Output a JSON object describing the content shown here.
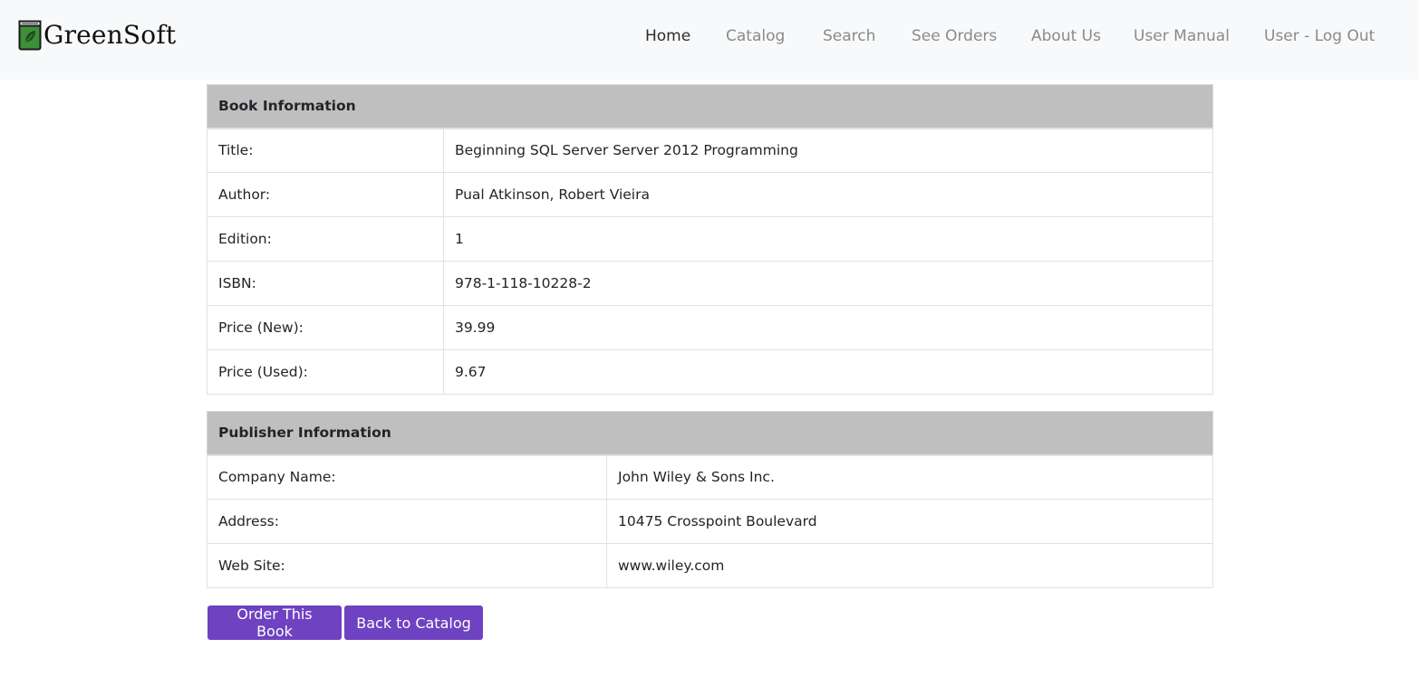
{
  "navbar": {
    "brand": "GreenSoft",
    "links": [
      {
        "label": "Home",
        "active": true
      },
      {
        "label": "Catalog",
        "active": false
      },
      {
        "label": "Search",
        "active": false
      },
      {
        "label": "See Orders",
        "active": false
      },
      {
        "label": "About Us",
        "active": false
      },
      {
        "label": "User Manual",
        "active": false
      },
      {
        "label": "User - Log Out",
        "active": false
      }
    ]
  },
  "book": {
    "heading": "Book Information",
    "rows": [
      {
        "label": "Title:",
        "value": "Beginning SQL Server Server 2012 Programming"
      },
      {
        "label": "Author:",
        "value": "Pual Atkinson, Robert Vieira"
      },
      {
        "label": "Edition:",
        "value": "1"
      },
      {
        "label": "ISBN:",
        "value": "978-1-118-10228-2"
      },
      {
        "label": "Price (New):",
        "value": "39.99"
      },
      {
        "label": "Price (Used):",
        "value": "9.67"
      }
    ]
  },
  "publisher": {
    "heading": "Publisher Information",
    "rows": [
      {
        "label": "Company Name:",
        "value": "John Wiley & Sons Inc."
      },
      {
        "label": "Address:",
        "value": "10475 Crosspoint Boulevard"
      },
      {
        "label": "Web Site:",
        "value": "www.wiley.com"
      }
    ]
  },
  "actions": {
    "order_label": "Order This Book",
    "back_label": "Back to Catalog"
  },
  "colors": {
    "navbar_bg": "#f8f9fa",
    "header_bg": "#bfbfbf",
    "button_bg": "#6f42c1",
    "logo_green": "#3f8f3a"
  },
  "icons": {
    "brand": "book-leaf-icon"
  }
}
